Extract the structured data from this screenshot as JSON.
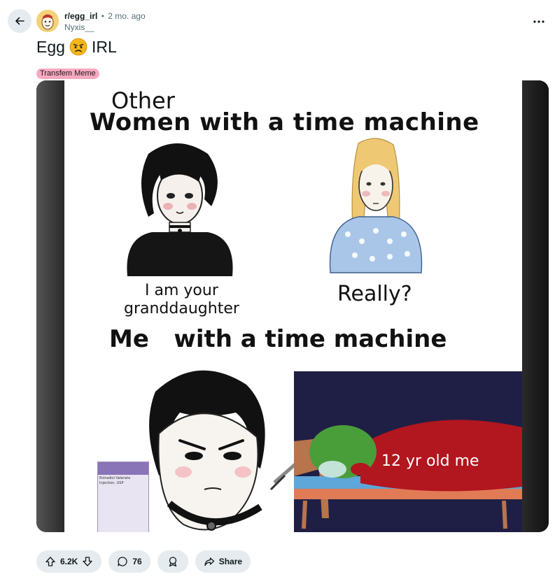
{
  "post": {
    "subreddit": "r/egg_irl",
    "age": "2 mo. ago",
    "author": "Nyxis__",
    "title_before": "Egg",
    "title_emoji": "angry-face-emoji",
    "title_after": "IRL",
    "flair": "Transfem Meme"
  },
  "meme": {
    "top_line1": "Other",
    "top_line2": "Women with a time machine",
    "caption_left": "I am your\ngranddaughter",
    "caption_right": "Really?",
    "mid_line": "Me   with a time machine",
    "bed_caption": "12 yr old me",
    "vial_label": "Estradiol Valerate Injection, USP"
  },
  "actions": {
    "votes": "6.2K",
    "comments": "76",
    "share": "Share"
  },
  "colors": {
    "flair_bg": "#f7a8c0",
    "pill_bg": "#e5ebee",
    "bed_bg": "#1f1f45"
  }
}
